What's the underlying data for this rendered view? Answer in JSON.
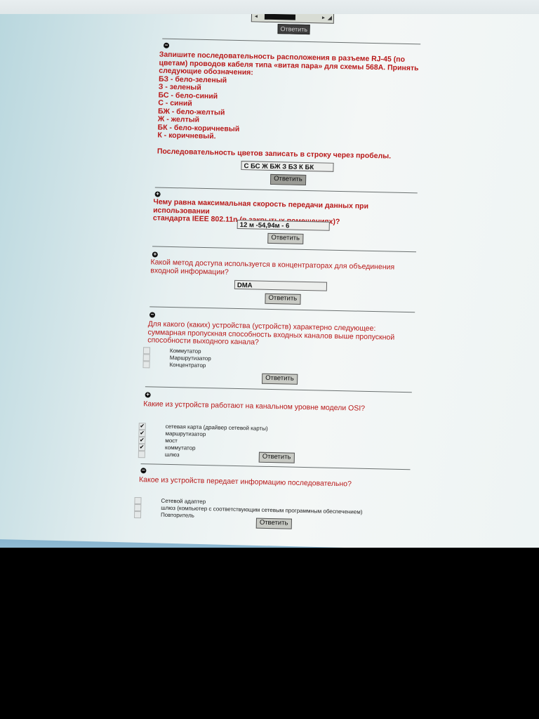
{
  "top": {
    "field_left_icon": "◂",
    "field_right_icon": "▸",
    "field_grip_icon": "◢",
    "submit_label": "Ответить"
  },
  "q1": {
    "toggle": "−",
    "lines": [
      "Запишите последовательность расположения в разъеме RJ-45 (по",
      "цветам) проводов кабеля типа «витая пара» для схемы 568A. Принять",
      "следующие обозначения:",
      "БЗ - бело-зеленый",
      "З - зеленый",
      "БС - бело-синий",
      "С - синий",
      "БЖ - бело-желтый",
      "Ж - желтый",
      "БК - бело-коричневый",
      "К - коричневый.",
      "",
      "Последовательность цветов записать в строку через пробелы."
    ],
    "answer": "С БС  Ж БЖ З БЗ К БК",
    "submit_label": "Ответить"
  },
  "q2": {
    "toggle": "+",
    "lines": [
      "Чему равна максимальная скорость передачи данных при использовании",
      "стандарта IEEE 802.11n (в закрытых помещениях)?"
    ],
    "answer": "12 м -54,94м - 6",
    "submit_label": "Ответить"
  },
  "q3": {
    "toggle": "+",
    "lines": [
      "Какой метод доступа используется в концентраторах для объединения",
      "входной информации?"
    ],
    "answer": "DMA",
    "submit_label": "Ответить"
  },
  "q4": {
    "toggle": "−",
    "lines": [
      "Для какого (каких) устройства (устройств) характерно следующее:",
      "суммарная пропускная способность входных каналов выше пропускной",
      "способности выходного канала?"
    ],
    "options": [
      "Коммутатор",
      "Маршрутизатор",
      "Концентратор"
    ],
    "checked": [
      false,
      false,
      false
    ],
    "submit_label": "Ответить"
  },
  "q5": {
    "toggle": "+",
    "lines": [
      "Какие из устройств работают на канальном уровне модели OSI?"
    ],
    "options": [
      "сетевая карта (драйвер сетевой карты)",
      "маршрутизатор",
      "мост",
      "коммутатор",
      "шлюз"
    ],
    "checked": [
      true,
      true,
      true,
      true,
      false
    ],
    "submit_label": "Ответить"
  },
  "q6": {
    "toggle": "−",
    "lines": [
      "Какое из устройств передает информацию последовательно?"
    ],
    "options": [
      "Сетевой адаптер",
      "шлюз (компьютер с соответствующим сетевым программным обеспечением)",
      "Повторитель"
    ],
    "checked": [
      false,
      false,
      false
    ],
    "submit_label": "Ответить"
  }
}
